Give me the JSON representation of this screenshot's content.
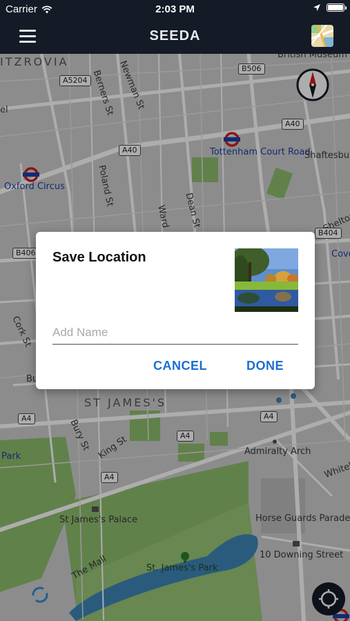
{
  "status_bar": {
    "carrier": "Carrier",
    "time": "2:03 PM",
    "wifi_icon": "wifi-icon",
    "location_icon": "location-arrow-icon",
    "battery_icon": "battery-icon"
  },
  "nav_bar": {
    "title": "SEEDA",
    "menu_icon": "hamburger-menu-icon",
    "map_icon": "map-thumbnail-icon"
  },
  "map": {
    "district_labels": [
      "ITZROVIA",
      "ST JAMES'S"
    ],
    "street_labels": [
      "Berners St",
      "Newman St",
      "Poland St",
      "Ward",
      "Dean St",
      "Cork St",
      "Bury St",
      "King St",
      "The Mall",
      "Shelton",
      "Whiteh",
      "el",
      "Bu"
    ],
    "place_labels": [
      "British Museum",
      "Shaftesbury Theatre",
      "Admiralty Arch",
      "St James's Palace",
      "Horse Guards Parade",
      "10 Downing Street",
      "St. James's Park"
    ],
    "station_labels": [
      "Tottenham Court Road",
      "Oxford Circus",
      "Park",
      "Cove"
    ],
    "road_badges": [
      "A5204",
      "B506",
      "A40",
      "A40",
      "B406",
      "A4",
      "A4",
      "A4",
      "A4",
      "B404"
    ],
    "colors": {
      "map_bg": "#cfcfcf",
      "road": "#ffffff",
      "park": "#8fbf6e",
      "water": "#3e86b8",
      "station_blue": "#1e40a6",
      "station_red": "#d41c1c"
    }
  },
  "compass": {
    "icon": "compass-icon"
  },
  "locate": {
    "icon": "locate-me-icon"
  },
  "dialog": {
    "title": "Save Location",
    "photo": "location-photo",
    "input_placeholder": "Add Name",
    "input_value": "",
    "cancel_label": "CANCEL",
    "done_label": "DONE",
    "accent": "#1a6fd1"
  }
}
